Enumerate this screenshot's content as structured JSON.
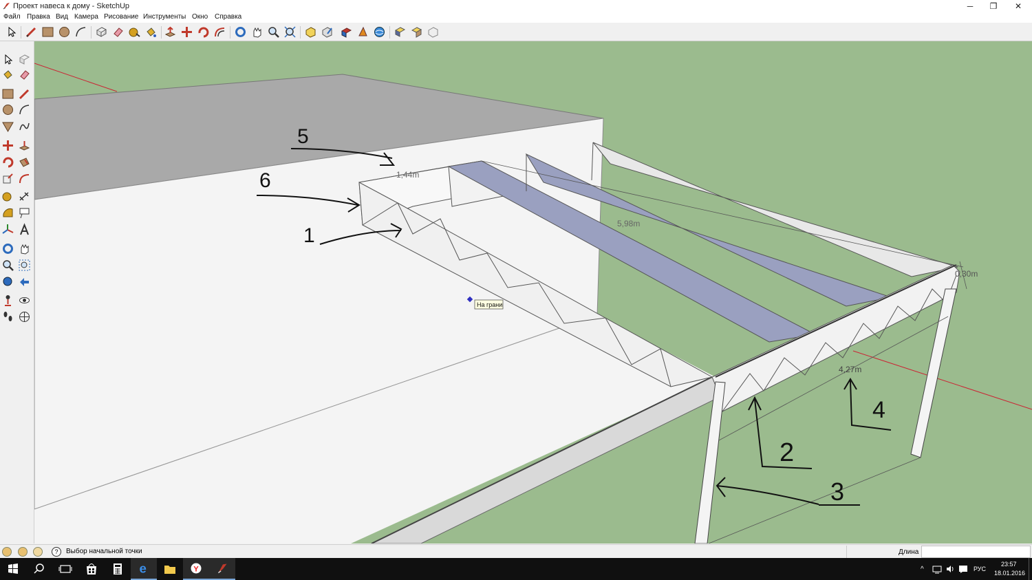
{
  "window": {
    "title": "Проект навеса к дому - SketchUp",
    "minimize_glyph": "─",
    "restore_glyph": "❐",
    "close_glyph": "✕"
  },
  "menu": [
    "Файл",
    "Правка",
    "Вид",
    "Камера",
    "Рисование",
    "Инструменты",
    "Окно",
    "Справка"
  ],
  "model": {
    "dimensions": [
      "1,44m",
      "5,98m",
      "0,30m",
      "4,27m"
    ],
    "tooltip": "На грани",
    "annotations": [
      "5",
      "6",
      "1",
      "2",
      "3",
      "4"
    ]
  },
  "status": {
    "hint": "Выбор начальной точки",
    "measurement_label": "Длина",
    "measurement_value": ""
  },
  "tray": {
    "language": "РУС",
    "time": "23:57",
    "date": "18.01.2016"
  },
  "colors": {
    "ground": "#9bbb8e",
    "roof": "#a9a9a9",
    "wall": "#f4f4f4",
    "panel": "#9aa0c0",
    "accent": "#0078d7"
  }
}
